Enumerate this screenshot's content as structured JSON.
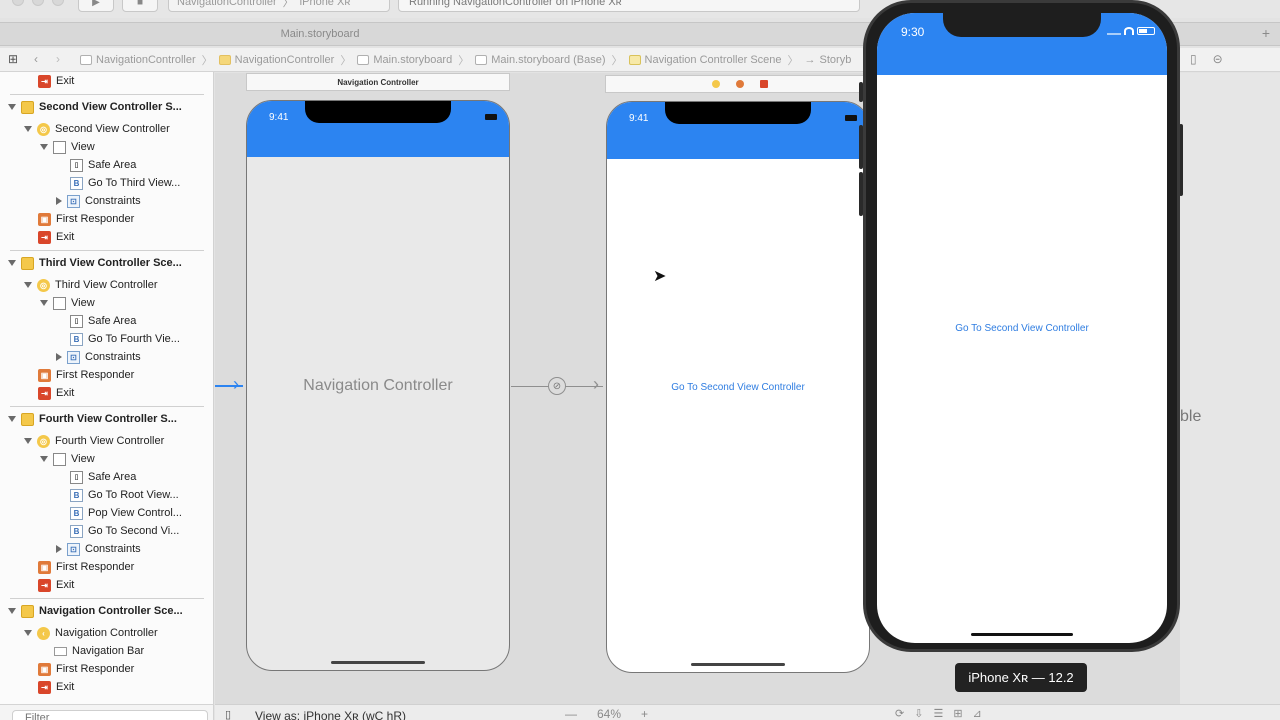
{
  "toolbar": {
    "scheme_project": "NavigationController",
    "scheme_device": "iPhone Xʀ",
    "activity": "Running NavigationController on iPhone Xʀ"
  },
  "tab": {
    "title": "Main.storyboard",
    "plus": "+"
  },
  "jumpbar": {
    "crumbs": [
      "NavigationController",
      "NavigationController",
      "Main.storyboard",
      "Main.storyboard (Base)",
      "Navigation Controller Scene",
      "Storyb"
    ]
  },
  "outline": {
    "items": [
      {
        "label": "Exit",
        "icon": "exit-icon"
      },
      {
        "label": "Second View Controller S...",
        "icon": "scene-icon"
      },
      {
        "label": "Second View Controller",
        "icon": "view-controller-icon"
      },
      {
        "label": "View",
        "icon": "view-icon"
      },
      {
        "label": "Safe Area",
        "icon": "safe-area-icon"
      },
      {
        "label": "Go To Third View...",
        "icon": "button-icon"
      },
      {
        "label": "Constraints",
        "icon": "constraints-icon"
      },
      {
        "label": "First Responder",
        "icon": "first-responder-icon"
      },
      {
        "label": "Exit",
        "icon": "exit-icon"
      },
      {
        "label": "Third View Controller Sce...",
        "icon": "scene-icon"
      },
      {
        "label": "Third View Controller",
        "icon": "view-controller-icon"
      },
      {
        "label": "View",
        "icon": "view-icon"
      },
      {
        "label": "Safe Area",
        "icon": "safe-area-icon"
      },
      {
        "label": "Go To Fourth Vie...",
        "icon": "button-icon"
      },
      {
        "label": "Constraints",
        "icon": "constraints-icon"
      },
      {
        "label": "First Responder",
        "icon": "first-responder-icon"
      },
      {
        "label": "Exit",
        "icon": "exit-icon"
      },
      {
        "label": "Fourth View Controller S...",
        "icon": "scene-icon"
      },
      {
        "label": "Fourth View Controller",
        "icon": "view-controller-icon"
      },
      {
        "label": "View",
        "icon": "view-icon"
      },
      {
        "label": "Safe Area",
        "icon": "safe-area-icon"
      },
      {
        "label": "Go To Root View...",
        "icon": "button-icon"
      },
      {
        "label": "Pop View Control...",
        "icon": "button-icon"
      },
      {
        "label": "Go To Second Vi...",
        "icon": "button-icon"
      },
      {
        "label": "Constraints",
        "icon": "constraints-icon"
      },
      {
        "label": "First Responder",
        "icon": "first-responder-icon"
      },
      {
        "label": "Exit",
        "icon": "exit-icon"
      },
      {
        "label": "Navigation Controller Sce...",
        "icon": "scene-icon"
      },
      {
        "label": "Navigation Controller",
        "icon": "navigation-controller-icon"
      },
      {
        "label": "Navigation Bar",
        "icon": "navigation-bar-icon"
      },
      {
        "label": "First Responder",
        "icon": "first-responder-icon"
      },
      {
        "label": "Exit",
        "icon": "exit-icon"
      }
    ],
    "filter_placeholder": "Filter"
  },
  "canvas": {
    "nav_scene_title": "Navigation Controller",
    "nav_phone_time": "9:41",
    "nav_controller_label": "Navigation Controller",
    "root_phone_time": "9:41",
    "root_button_label": "Go To Second View Controller",
    "clipped_text": "ble"
  },
  "bottombar": {
    "view_as": "View as: iPhone Xʀ (wC hR)",
    "zoom_minus": "—",
    "zoom_level": "64%",
    "zoom_plus": "+"
  },
  "simulator": {
    "time": "9:30",
    "button_label": "Go To Second View Controller",
    "tooltip": "iPhone Xʀ — 12.2"
  },
  "colors": {
    "nav_bar_blue": "#2c84f1",
    "link_blue": "#2f7de1",
    "canvas_bg": "#dcdcdc"
  }
}
